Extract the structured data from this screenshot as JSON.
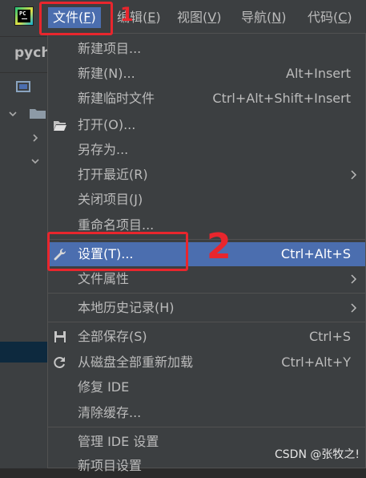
{
  "menubar": {
    "items": [
      {
        "label": "文件(F)",
        "text": "文件(",
        "key": "F",
        "end": ")"
      },
      {
        "label": "编辑(E)",
        "text": "编辑(",
        "key": "E",
        "end": ")"
      },
      {
        "label": "视图(V)",
        "text": "视图(",
        "key": "V",
        "end": ")"
      },
      {
        "label": "导航(N)",
        "text": "导航(",
        "key": "N",
        "end": ")"
      },
      {
        "label": "代码(C)",
        "text": "代码(",
        "key": "C",
        "end": ")"
      }
    ]
  },
  "project": {
    "title": "pych"
  },
  "file_menu": {
    "items": [
      {
        "label": "新建项目..."
      },
      {
        "label": "新建(N)...",
        "shortcut": "Alt+Insert"
      },
      {
        "label": "新建临时文件",
        "shortcut": "Ctrl+Alt+Shift+Insert"
      },
      {
        "label": "打开(O)..."
      },
      {
        "label": "另存为..."
      },
      {
        "label": "打开最近(R)"
      },
      {
        "label": "关闭项目(J)"
      },
      {
        "label": "重命名项目..."
      },
      {
        "label": "设置(T)...",
        "shortcut": "Ctrl+Alt+S"
      },
      {
        "label": "文件属性"
      },
      {
        "label": "本地历史记录(H)"
      },
      {
        "label": "全部保存(S)",
        "shortcut": "Ctrl+S"
      },
      {
        "label": "从磁盘全部重新加载",
        "shortcut": "Ctrl+Alt+Y"
      },
      {
        "label": "修复 IDE"
      },
      {
        "label": "清除缓存..."
      },
      {
        "label": "管理 IDE 设置"
      },
      {
        "label": "新项目设置"
      }
    ]
  },
  "annotations": {
    "step1": "1",
    "step2": "2"
  },
  "watermark": "CSDN @张牧之!",
  "colors": {
    "selection": "#4b6eaf",
    "annotation": "#e8262d",
    "background": "#3c3f41"
  }
}
